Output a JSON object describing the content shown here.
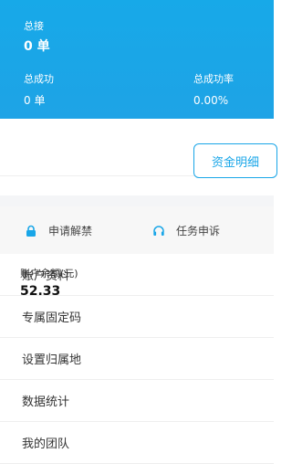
{
  "colors": {
    "brand": "#17a9e8",
    "background": "#ffffff"
  },
  "header": {
    "total_orders_label": "总接",
    "total_orders_value": "0 单",
    "total_success_label": "总成功",
    "total_success_value": "0 单",
    "success_rate_label": "总成功率",
    "success_rate_value": "0.00%"
  },
  "account": {
    "balance_label": "账户余额(元)",
    "balance_value": "52.33",
    "fund_details_label": "资金明细"
  },
  "actions": {
    "unblock_label": "申请解禁",
    "unblock_icon": "lock-icon",
    "appeal_label": "任务申诉",
    "appeal_icon": "headset-icon"
  },
  "menu": {
    "items": [
      {
        "label": "账户资料"
      },
      {
        "label": "专属固定码"
      },
      {
        "label": "设置归属地"
      },
      {
        "label": "数据统计"
      },
      {
        "label": "我的团队"
      }
    ]
  }
}
